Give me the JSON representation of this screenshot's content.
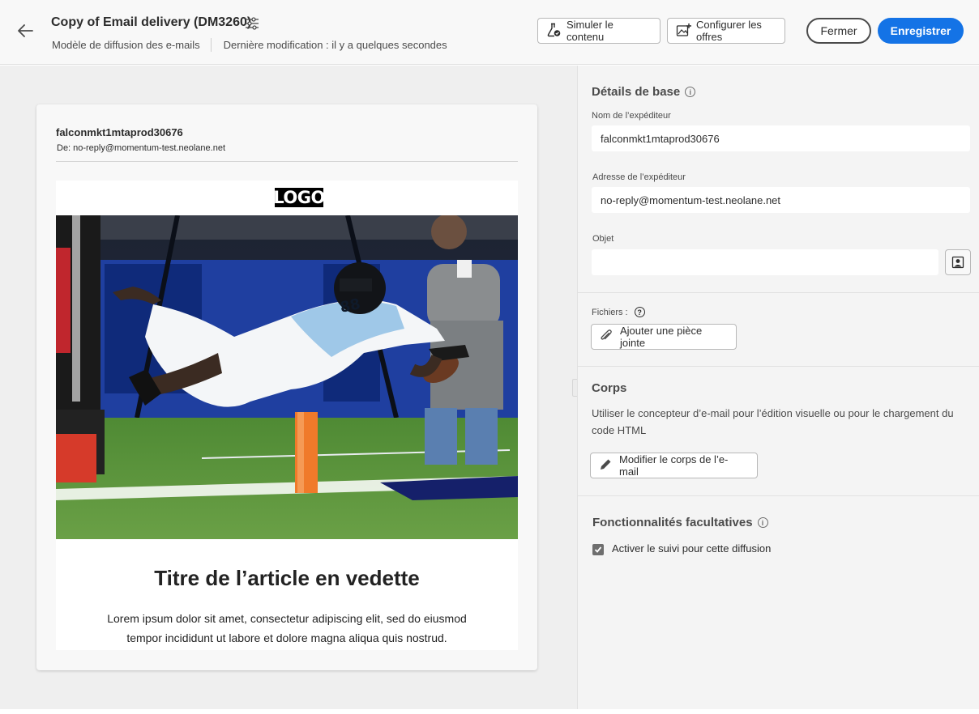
{
  "header": {
    "title": "Copy of Email delivery (DM3260)",
    "template_label": "Modèle de diffusion des e-mails",
    "last_modified": "Dernière modification : il y a quelques secondes",
    "simulate_label": "Simuler le contenu",
    "offers_label": "Configurer les offres",
    "close_label": "Fermer",
    "save_label": "Enregistrer"
  },
  "preview": {
    "sender_name": "falconmkt1mtaprod30676",
    "from_prefix": "De:",
    "from_address": "no-reply@momentum-test.neolane.net",
    "logo_text": "LOGO",
    "article_title": "Titre de l’article en vedette",
    "article_text": "Lorem ipsum dolor sit amet, consectetur adipiscing elit, sed do eiusmod tempor incididunt ut labore et dolore magna aliqua quis nostrud."
  },
  "panel": {
    "basic_details_title": "Détails de base",
    "sender_name_label": "Nom de l’expéditeur",
    "sender_name_value": "falconmkt1mtaprod30676",
    "sender_address_label": "Adresse de l’expéditeur",
    "sender_address_value": "no-reply@momentum-test.neolane.net",
    "subject_label": "Objet",
    "subject_value": "",
    "files_label": "Fichiers :",
    "attach_label": "Ajouter une pièce jointe",
    "body_title": "Corps",
    "body_desc": "Utiliser le concepteur d’e-mail pour l’édition visuelle ou pour le chargement du code HTML",
    "edit_body_label": "Modifier le corps de l’e-mail",
    "optional_title": "Fonctionnalités facultatives",
    "tracking_label": "Activer le suivi pour cette diffusion",
    "tracking_checked": true
  },
  "colors": {
    "accent": "#1473e6",
    "header_bg": "#f8f8f8",
    "panel_bg": "#f4f4f4",
    "preview_bg": "#efefef"
  },
  "icons": [
    "back-arrow-icon",
    "settings-sliders-icon",
    "flask-icon",
    "image-add-icon",
    "info-icon",
    "personalization-icon",
    "paperclip-icon",
    "help-icon",
    "pencil-icon",
    "checkmark-icon"
  ]
}
